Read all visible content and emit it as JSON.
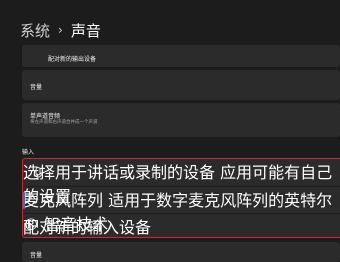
{
  "breadcrumb": {
    "parent": "系统",
    "separator": "›",
    "current": "声音"
  },
  "output": {
    "pair_new": "配对新的输出设备",
    "volume": "音量",
    "mono_title": "单声道音频",
    "mono_desc": "将左声道和右声道合并成一个声道"
  },
  "input": {
    "section_title": "输入",
    "choose_title": "选择用于讲话或录制的设备",
    "choose_desc": "应用可能有自己的设置",
    "array_title": "麦克风阵列",
    "array_desc": "适用于数字麦克风阵列的英特尔® 智音技术",
    "pair_new": "配对新的输入设备",
    "volume": "音量"
  },
  "colors": {
    "background": "#1c1c1c",
    "card": "#2b2b2b",
    "highlight_border": "#c42b35"
  },
  "icons": {
    "mic": "microphone-icon"
  }
}
